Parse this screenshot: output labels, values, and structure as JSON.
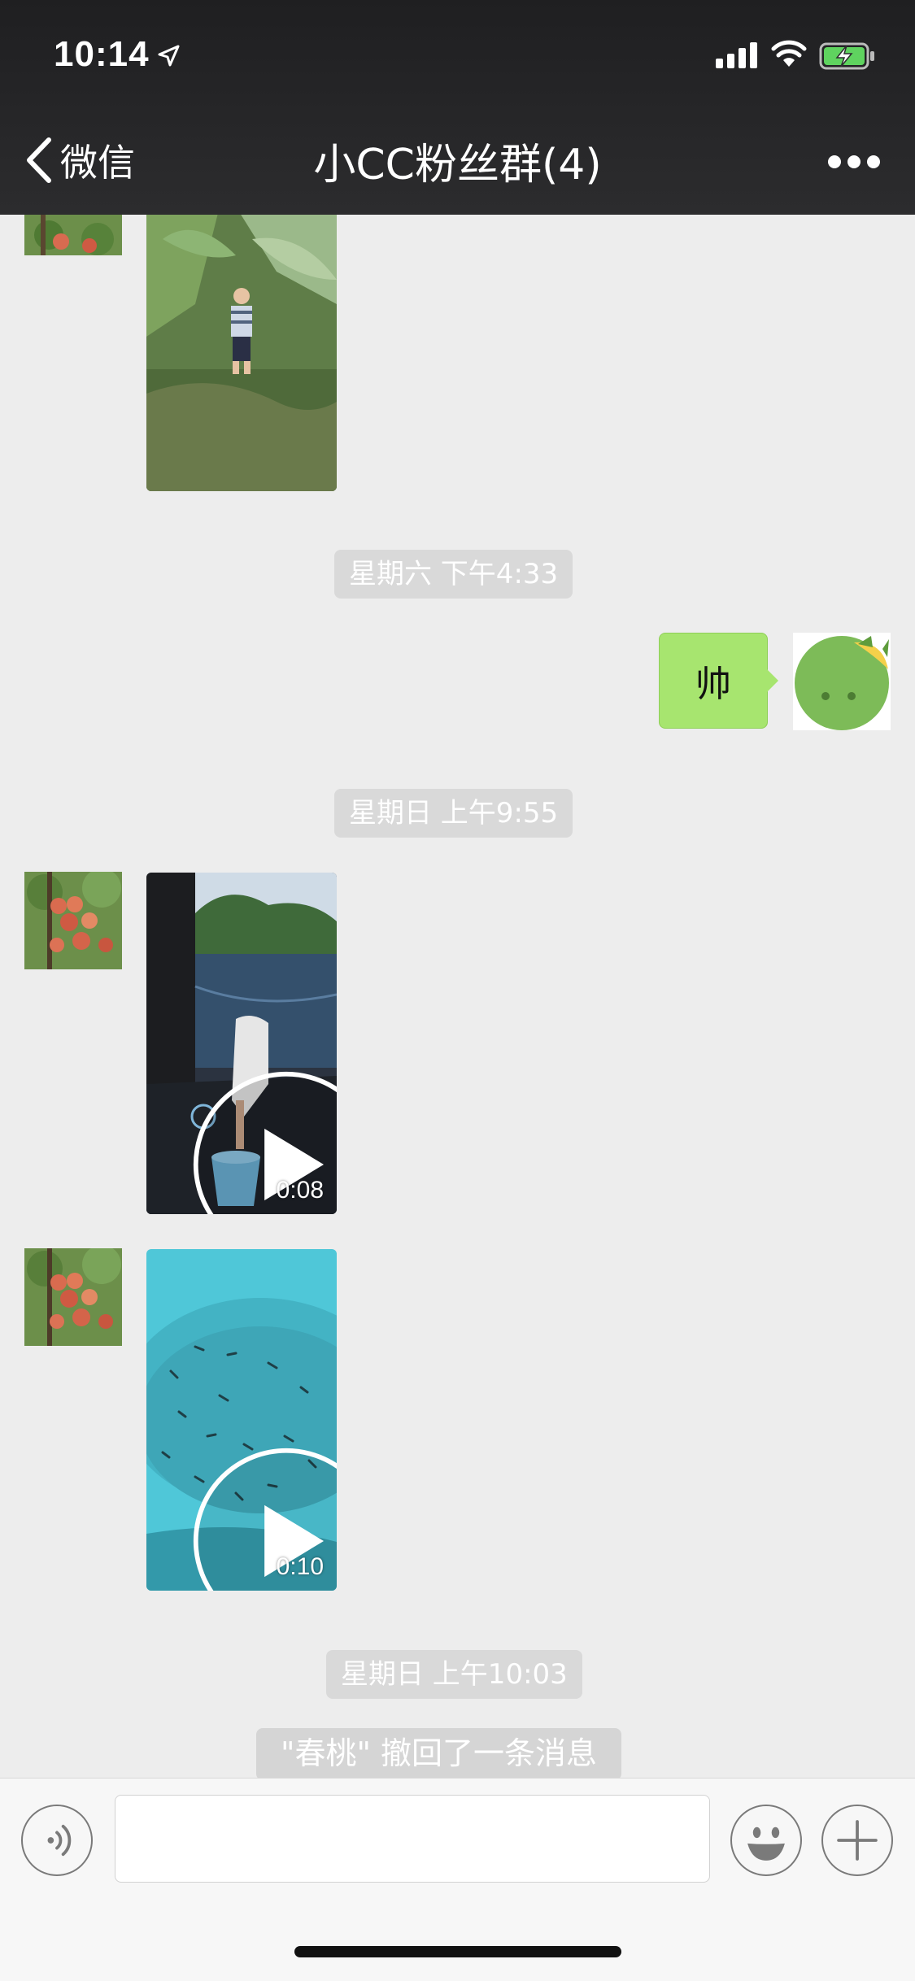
{
  "status_bar": {
    "time": "10:14",
    "location_icon": "location-arrow-icon",
    "signal_icon": "signal-bars-icon",
    "wifi_icon": "wifi-icon",
    "battery_icon": "battery-charging-icon"
  },
  "nav": {
    "back_label": "微信",
    "title": "小CC粉丝群(4)",
    "more_icon": "more-dots-icon"
  },
  "messages": {
    "timestamp_1": "星期六 下午4:33",
    "text_message": "帅",
    "timestamp_2": "星期日 上午9:55",
    "video_1_duration": "0:08",
    "video_2_duration": "0:10",
    "timestamp_3": "星期日 上午10:03",
    "system_notice": "\"春桃\" 撤回了一条消息"
  },
  "input_bar": {
    "voice_icon": "voice-icon",
    "emoji_icon": "emoji-icon",
    "plus_icon": "plus-icon",
    "input_value": ""
  },
  "colors": {
    "header_bg": "#2c2c2e",
    "chat_bg": "#ededed",
    "bubble_green": "#a7e56f",
    "battery_green": "#5fd35f"
  }
}
